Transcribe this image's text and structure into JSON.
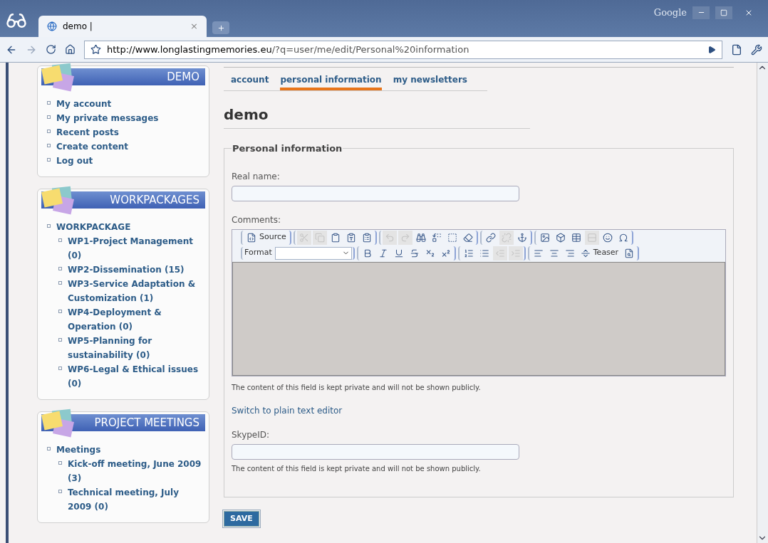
{
  "browser": {
    "tab": {
      "title": "demo |",
      "close": "×"
    },
    "url_host": "http://www.longlastingmemories.eu",
    "url_path": "/?q=user/me/edit/Personal%20information",
    "brand": "Google"
  },
  "sidebar": [
    {
      "title": "DEMO",
      "items": [
        {
          "label": "My account"
        },
        {
          "label": "My private messages"
        },
        {
          "label": "Recent posts"
        },
        {
          "label": "Create content"
        },
        {
          "label": "Log out"
        }
      ]
    },
    {
      "title": "WORKPACKAGES",
      "items": [
        {
          "label": "WORKPACKAGE",
          "children": [
            {
              "label": "WP1-Project Management (0)"
            },
            {
              "label": "WP2-Dissemination (15)"
            },
            {
              "label": "WP3-Service Adaptation & Customization (1)"
            },
            {
              "label": "WP4-Deployment & Operation (0)"
            },
            {
              "label": "WP5-Planning for sustainability (0)"
            },
            {
              "label": "WP6-Legal & Ethical issues (0)"
            }
          ]
        }
      ]
    },
    {
      "title": "PROJECT MEETINGS",
      "items": [
        {
          "label": "Meetings",
          "children": [
            {
              "label": "Kick-off meeting, June 2009 (3)"
            },
            {
              "label": "Technical meeting, July 2009 (0)"
            }
          ]
        }
      ]
    }
  ],
  "tabs": [
    {
      "label": "account",
      "selected": false
    },
    {
      "label": "personal information",
      "selected": true
    },
    {
      "label": "my newsletters",
      "selected": false
    }
  ],
  "heading": "demo",
  "fieldset": {
    "legend": "Personal information",
    "real_name": {
      "label": "Real name:"
    },
    "comments": {
      "label": "Comments:",
      "help": "The content of this field is kept private and will not be shown publicly.",
      "switch_link": "Switch to plain text editor",
      "toolbar": [
        [
          [
            {
              "kind": "source",
              "label": "Source",
              "disabled": false
            }
          ],
          [
            {
              "kind": "cut",
              "disabled": true
            },
            {
              "kind": "copy",
              "disabled": true
            },
            {
              "kind": "paste",
              "disabled": false
            },
            {
              "kind": "paste_text",
              "disabled": false
            },
            {
              "kind": "paste_word",
              "disabled": false
            }
          ],
          [
            {
              "kind": "undo",
              "disabled": true
            },
            {
              "kind": "redo",
              "disabled": true
            },
            {
              "kind": "find",
              "disabled": false
            },
            {
              "kind": "replace",
              "disabled": false
            },
            {
              "kind": "select_all",
              "disabled": false
            },
            {
              "kind": "remove_format",
              "disabled": false
            }
          ],
          [
            {
              "kind": "link",
              "disabled": false
            },
            {
              "kind": "unlink",
              "disabled": true
            },
            {
              "kind": "anchor",
              "disabled": false
            }
          ],
          [
            {
              "kind": "image",
              "disabled": false
            },
            {
              "kind": "flash",
              "disabled": false
            },
            {
              "kind": "table",
              "disabled": false
            },
            {
              "kind": "hr",
              "disabled": true
            },
            {
              "kind": "smiley",
              "disabled": false
            },
            {
              "kind": "special_char",
              "disabled": false
            }
          ]
        ],
        [
          [
            {
              "kind": "format",
              "label": "Format",
              "disabled": false
            }
          ],
          [
            {
              "kind": "bold",
              "disabled": false
            },
            {
              "kind": "italic",
              "disabled": false
            },
            {
              "kind": "underline",
              "disabled": false
            },
            {
              "kind": "strike",
              "disabled": false
            },
            {
              "kind": "subscript",
              "disabled": false
            },
            {
              "kind": "superscript",
              "disabled": false
            }
          ],
          [
            {
              "kind": "ordered_list",
              "disabled": false
            },
            {
              "kind": "bullet_list",
              "disabled": false
            },
            {
              "kind": "outdent",
              "disabled": true
            },
            {
              "kind": "indent",
              "disabled": true
            }
          ],
          [
            {
              "kind": "align_left",
              "disabled": false
            },
            {
              "kind": "align_center",
              "disabled": false
            },
            {
              "kind": "align_right",
              "disabled": false
            },
            {
              "kind": "teaser",
              "label": "Teaser",
              "disabled": false
            },
            {
              "kind": "preview",
              "disabled": false
            }
          ]
        ]
      ]
    },
    "skype": {
      "label": "SkypeID:",
      "help": "The content of this field is kept private and will not be shown publicly."
    }
  },
  "save_button": "SAVE"
}
